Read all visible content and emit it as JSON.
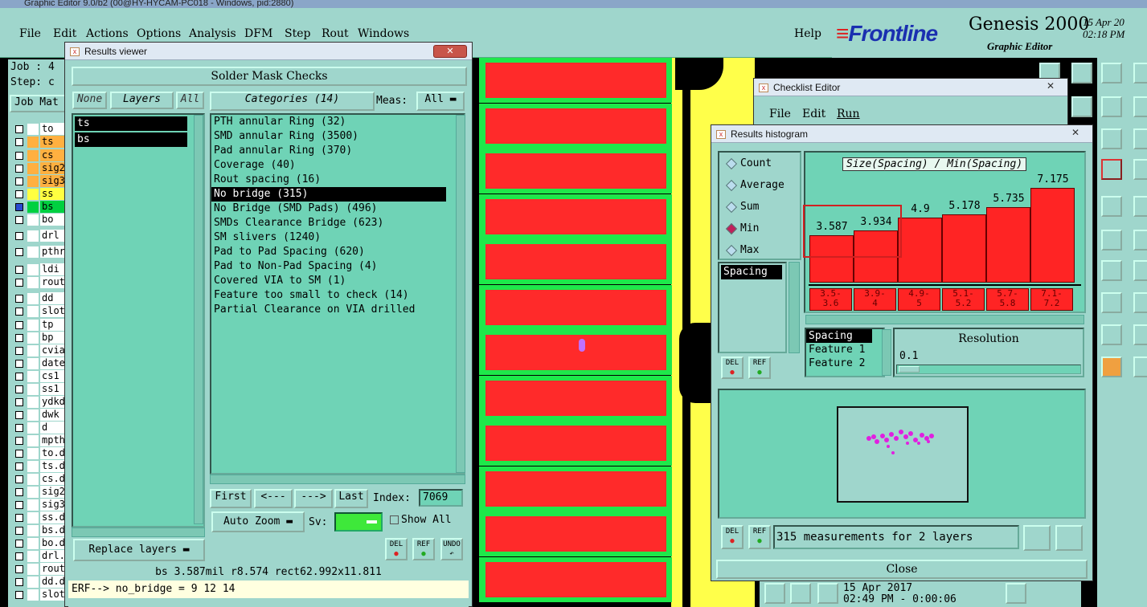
{
  "main": {
    "title": "Graphic Editor 9.0/b2 (00@HY-HYCAM-PC018 - Windows, pid:2880)",
    "menu": [
      "File",
      "Edit",
      "Actions",
      "Options",
      "Analysis",
      "DFM",
      "Step",
      "Rout",
      "Windows"
    ],
    "help": "Help",
    "brand": "Frontline",
    "product": "Genesis 2000",
    "subtitle": "Graphic Editor",
    "date_line1": "15 Apr 20",
    "date_line2": "02:18 PM",
    "job_label": "Job : 4",
    "step_label": "Step: c",
    "job_matrix": "Job Mat",
    "layers": [
      {
        "name": "to",
        "color": "#ffffff"
      },
      {
        "name": "ts",
        "color": "#ffb040"
      },
      {
        "name": "cs",
        "color": "#ffb040"
      },
      {
        "name": "sig2",
        "color": "#ffb040"
      },
      {
        "name": "sig3",
        "color": "#ffb040"
      },
      {
        "name": "ss",
        "color": "#ffff40"
      },
      {
        "name": "bs",
        "color": "#00d040"
      },
      {
        "name": "bo",
        "color": "#ffffff"
      },
      {
        "name": "drl",
        "color": "#ffffff"
      },
      {
        "name": "pthr",
        "color": "#ffffff"
      },
      {
        "name": "ldi",
        "color": "#ffffff"
      },
      {
        "name": "rout",
        "color": "#ffffff"
      },
      {
        "name": "dd",
        "color": "#ffffff"
      },
      {
        "name": "slot",
        "color": "#ffffff"
      },
      {
        "name": "tp",
        "color": "#ffffff"
      },
      {
        "name": "bp",
        "color": "#ffffff"
      },
      {
        "name": "cvia",
        "color": "#ffffff"
      },
      {
        "name": "date",
        "color": "#ffffff"
      },
      {
        "name": "cs1",
        "color": "#ffffff"
      },
      {
        "name": "ss1",
        "color": "#ffffff"
      },
      {
        "name": "ydkd",
        "color": "#ffffff"
      },
      {
        "name": "dwk",
        "color": "#ffffff"
      },
      {
        "name": "d",
        "color": "#ffffff"
      },
      {
        "name": "mpth",
        "color": "#ffffff"
      },
      {
        "name": "to.d",
        "color": "#ffffff"
      },
      {
        "name": "ts.d",
        "color": "#ffffff"
      },
      {
        "name": "cs.d",
        "color": "#ffffff"
      },
      {
        "name": "sig2",
        "color": "#ffffff"
      },
      {
        "name": "sig3",
        "color": "#ffffff"
      },
      {
        "name": "ss.d",
        "color": "#ffffff"
      },
      {
        "name": "bs.d",
        "color": "#ffffff"
      },
      {
        "name": "bo.d",
        "color": "#ffffff"
      },
      {
        "name": "drl.",
        "color": "#ffffff"
      },
      {
        "name": "rout",
        "color": "#ffffff"
      },
      {
        "name": "dd.d",
        "color": "#ffffff"
      },
      {
        "name": "slot",
        "color": "#ffffff"
      }
    ]
  },
  "results_viewer": {
    "title": "Results viewer",
    "header": "Solder Mask Checks",
    "btn_none": "None",
    "btn_layers": "Layers",
    "btn_all": "All",
    "categories_btn": "Categories (14)",
    "meas_label": "Meas:",
    "meas_value": "All",
    "layer_items": [
      "ts",
      "bs"
    ],
    "categories": [
      "PTH annular Ring (32)",
      "SMD annular Ring (3500)",
      "Pad annular Ring (370)",
      "Coverage (40)",
      "Rout spacing (16)",
      "No bridge (315)",
      "No Bridge (SMD Pads) (496)",
      "SMDs Clearance Bridge (623)",
      "SM slivers (1240)",
      "Pad to Pad Spacing (620)",
      "Pad to Non-Pad Spacing (4)",
      "Covered VIA to SM (1)",
      "Feature too small to check (14)",
      "Partial Clearance on VIA drilled"
    ],
    "selected_index": 5,
    "nav": {
      "first": "First",
      "prev": "<---",
      "next": "--->",
      "last": "Last",
      "index_label": "Index:",
      "index_value": "7069"
    },
    "auto_zoom": "Auto Zoom",
    "sv_label": "Sv:",
    "show_all": "Show All",
    "replace_layers": "Replace layers",
    "del": "DEL",
    "ref": "REF",
    "undo": "UNDO",
    "status": "bs 3.587mil   r8.574  rect62.992x11.811",
    "erf": "ERF--> no_bridge = 9 12 14"
  },
  "checklist_editor": {
    "title": "Checklist Editor",
    "menu": [
      "File",
      "Edit",
      "Run"
    ]
  },
  "histogram": {
    "title": "Results histogram",
    "modes": [
      "Count",
      "Average",
      "Sum",
      "Min",
      "Max"
    ],
    "selected_mode": "Min",
    "chart_title": "Size(Spacing) / Min(Spacing)",
    "list_items": [
      "Spacing"
    ],
    "fields": [
      "Spacing",
      "Feature 1",
      "Feature 2"
    ],
    "resolution_label": "Resolution",
    "resolution_value": "0.1",
    "summary": "315 measurements for 2 layers",
    "close": "Close",
    "del": "DEL",
    "ref": "REF"
  },
  "chart_data": {
    "type": "bar",
    "title": "Size(Spacing) / Min(Spacing)",
    "categories": [
      "3.5-3.6",
      "3.9-4",
      "4.9-5",
      "5.1-5.2",
      "5.7-5.8",
      "7.1-7.2"
    ],
    "values": [
      3.587,
      3.934,
      4.9,
      5.178,
      5.735,
      7.175
    ],
    "value_labels": [
      "3.587",
      "3.934",
      "4.9",
      "5.178",
      "5.735",
      "7.175"
    ],
    "bin_labels_top": [
      "3.5-",
      "3.9-",
      "4.9-",
      "5.1-",
      "5.7-",
      "7.1-"
    ],
    "bin_labels_bottom": [
      "3.6",
      "4",
      "5",
      "5.2",
      "5.8",
      "7.2"
    ],
    "ylim": [
      0,
      7.175
    ],
    "bar_color": "#ff2424"
  },
  "bottom_status": {
    "date": "15 Apr 2017",
    "time": "02:49 PM - 0:00:06"
  }
}
